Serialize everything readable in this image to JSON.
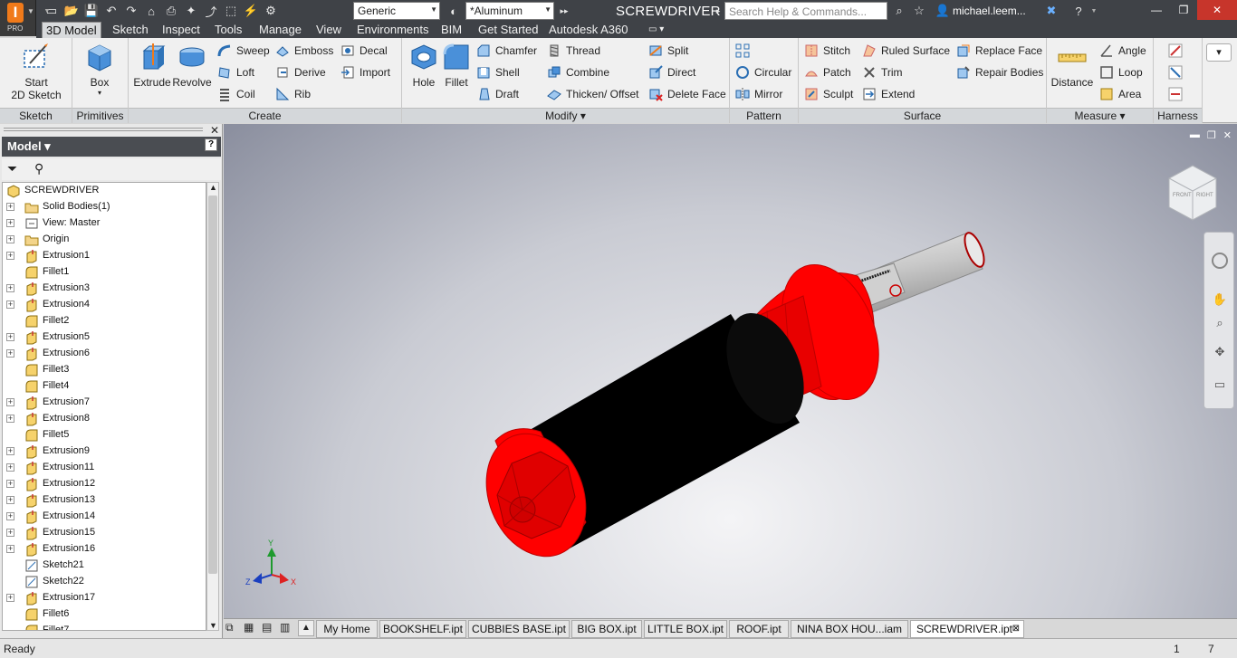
{
  "app": {
    "title": "SCREWDRIVER",
    "logo_text": "I",
    "logo_edition": "PRO",
    "material_combo": "Generic",
    "appearance_combo": "*Aluminum",
    "search_placeholder": "Search Help & Commands...",
    "user": "michael.leem...",
    "accent_color": "#f07a1a"
  },
  "ribbon_tabs": [
    {
      "label": "3D Model",
      "active": true
    },
    {
      "label": "Sketch"
    },
    {
      "label": "Inspect"
    },
    {
      "label": "Tools"
    },
    {
      "label": "Manage"
    },
    {
      "label": "View"
    },
    {
      "label": "Environments"
    },
    {
      "label": "BIM"
    },
    {
      "label": "Get Started"
    },
    {
      "label": "Autodesk A360"
    }
  ],
  "panels": {
    "sketch": {
      "label": "Sketch",
      "start_line1": "Start",
      "start_line2": "2D Sketch"
    },
    "primitives": {
      "label": "Primitives",
      "box": "Box"
    },
    "create": {
      "label": "Create",
      "extrude": "Extrude",
      "revolve": "Revolve",
      "sweep": "Sweep",
      "loft": "Loft",
      "coil": "Coil",
      "emboss": "Emboss",
      "derive": "Derive",
      "rib": "Rib",
      "decal": "Decal",
      "import": "Import"
    },
    "modify": {
      "label": "Modify ▾",
      "hole": "Hole",
      "fillet": "Fillet",
      "chamfer": "Chamfer",
      "shell": "Shell",
      "draft": "Draft",
      "thread": "Thread",
      "combine": "Combine",
      "thicken": "Thicken/ Offset",
      "split": "Split",
      "direct": "Direct",
      "delete_face": "Delete Face"
    },
    "pattern": {
      "label": "Pattern",
      "circular": "Circular",
      "mirror": "Mirror"
    },
    "surface": {
      "label": "Surface",
      "stitch": "Stitch",
      "patch": "Patch",
      "sculpt": "Sculpt",
      "ruled": "Ruled Surface",
      "trim": "Trim",
      "extend": "Extend",
      "replace": "Replace Face",
      "repair": "Repair Bodies"
    },
    "measure": {
      "label": "Measure ▾",
      "distance": "Distance",
      "angle": "Angle",
      "loop": "Loop",
      "area": "Area"
    },
    "harness": {
      "label": "Harness"
    }
  },
  "browser": {
    "title": "Model ▾",
    "items": [
      {
        "label": "SCREWDRIVER",
        "icon": "part-icon",
        "root": true
      },
      {
        "label": "Solid Bodies(1)",
        "icon": "folder-icon",
        "expand": true
      },
      {
        "label": "View: Master",
        "icon": "view-icon",
        "expand": true
      },
      {
        "label": "Origin",
        "icon": "folder-icon",
        "expand": true
      },
      {
        "label": "Extrusion1",
        "icon": "extrude-icon",
        "expand": true
      },
      {
        "label": "Fillet1",
        "icon": "fillet-icon"
      },
      {
        "label": "Extrusion3",
        "icon": "extrude-icon",
        "expand": true
      },
      {
        "label": "Extrusion4",
        "icon": "extrude-icon",
        "expand": true
      },
      {
        "label": "Fillet2",
        "icon": "fillet-icon"
      },
      {
        "label": "Extrusion5",
        "icon": "extrude-icon",
        "expand": true
      },
      {
        "label": "Extrusion6",
        "icon": "extrude-icon",
        "expand": true
      },
      {
        "label": "Fillet3",
        "icon": "fillet-icon"
      },
      {
        "label": "Fillet4",
        "icon": "fillet-icon"
      },
      {
        "label": "Extrusion7",
        "icon": "extrude-icon",
        "expand": true
      },
      {
        "label": "Extrusion8",
        "icon": "extrude-icon",
        "expand": true
      },
      {
        "label": "Fillet5",
        "icon": "fillet-icon"
      },
      {
        "label": "Extrusion9",
        "icon": "extrude-icon",
        "expand": true
      },
      {
        "label": "Extrusion11",
        "icon": "extrude-icon",
        "expand": true
      },
      {
        "label": "Extrusion12",
        "icon": "extrude-icon",
        "expand": true
      },
      {
        "label": "Extrusion13",
        "icon": "extrude-icon",
        "expand": true
      },
      {
        "label": "Extrusion14",
        "icon": "extrude-icon",
        "expand": true
      },
      {
        "label": "Extrusion15",
        "icon": "extrude-icon",
        "expand": true
      },
      {
        "label": "Extrusion16",
        "icon": "extrude-icon",
        "expand": true
      },
      {
        "label": "Sketch21",
        "icon": "sketch-icon"
      },
      {
        "label": "Sketch22",
        "icon": "sketch-icon"
      },
      {
        "label": "Extrusion17",
        "icon": "extrude-icon",
        "expand": true
      },
      {
        "label": "Fillet6",
        "icon": "fillet-icon"
      },
      {
        "label": "Fillet7",
        "icon": "fillet-icon"
      }
    ]
  },
  "viewcube": {
    "front": "FRONT",
    "right": "RIGHT"
  },
  "triad": {
    "x": "X",
    "y": "Y",
    "z": "Z"
  },
  "doc_tabs": [
    {
      "label": "My Home"
    },
    {
      "label": "BOOKSHELF.ipt"
    },
    {
      "label": "CUBBIES BASE.ipt"
    },
    {
      "label": "BIG BOX.ipt"
    },
    {
      "label": "LITTLE BOX.ipt"
    },
    {
      "label": "ROOF.ipt"
    },
    {
      "label": "NINA BOX HOU...iam"
    },
    {
      "label": "SCREWDRIVER.ipt",
      "active": true
    }
  ],
  "status": {
    "text": "Ready",
    "count1": "1",
    "count2": "7"
  },
  "colors": {
    "handle_red": "#ff0000",
    "grip_black": "#000000",
    "shaft": "#c8c8c8"
  }
}
